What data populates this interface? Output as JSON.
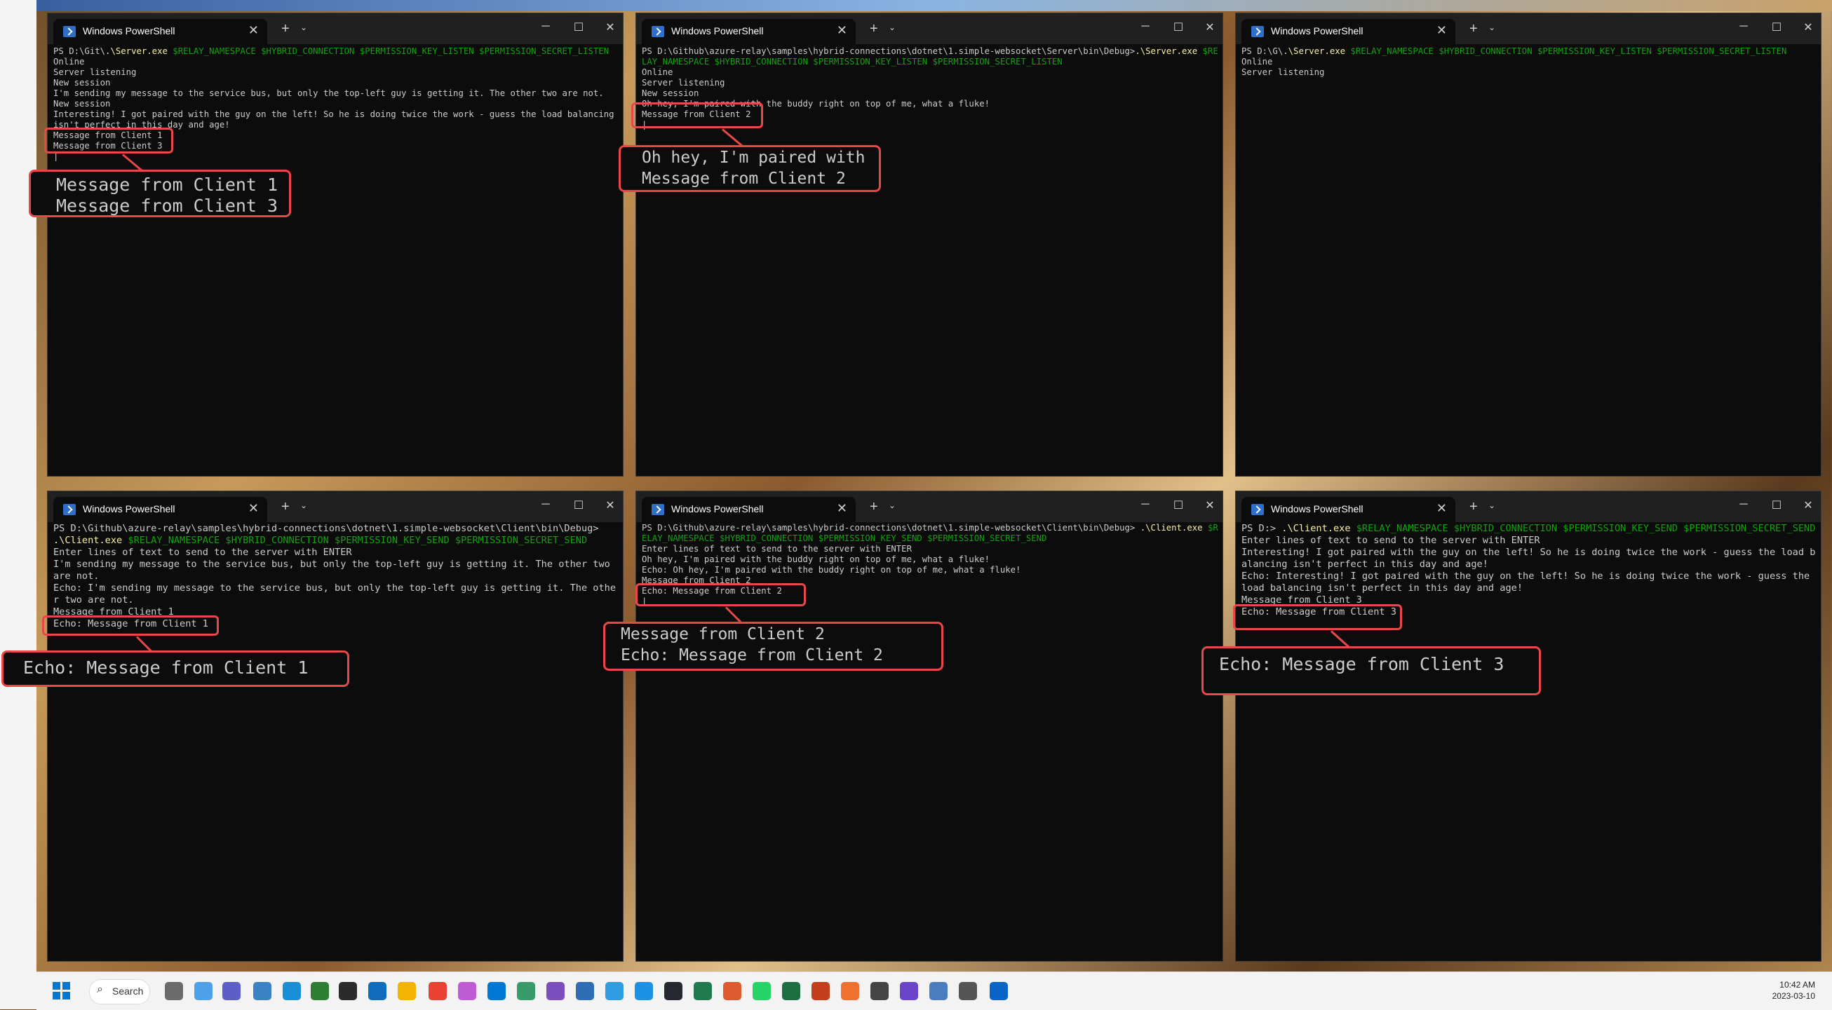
{
  "window_title": "Windows PowerShell",
  "window_controls": {
    "minimize": "─",
    "maximize": "☐",
    "close": "✕"
  },
  "tab_close": "✕",
  "new_tab": "+",
  "dropdown": "⌄",
  "terminals": [
    {
      "segments": [
        [
          {
            "t": "PS D:\\Git\\"
          },
          {
            "t": ".\\Server.exe",
            "c": "y"
          },
          {
            "t": " $RELAY_NAMESPACE $HYBRID_CONNECTION $PERMISSION_KEY_LISTEN $PERMISSION_SECRET_LISTEN",
            "c": "g"
          }
        ],
        [
          {
            "t": "Online"
          }
        ],
        [
          {
            "t": "Server listening"
          }
        ],
        [
          {
            "t": "New session"
          }
        ],
        [
          {
            "t": "I'm sending my message to the service bus, but only the top-left guy is getting it. The other two are not."
          }
        ],
        [
          {
            "t": "New session"
          }
        ],
        [
          {
            "t": "Interesting! I got paired with the guy on the left! So he is doing twice the work - guess the load balancing isn't perfect in this day and age!"
          }
        ],
        [
          {
            "t": "Message from Client 1"
          }
        ],
        [
          {
            "t": "Message from Client 3"
          }
        ],
        [
          {
            "t": "|"
          }
        ]
      ],
      "zoom": [
        "Message from Client 1",
        "Message from Client 3"
      ]
    },
    {
      "segments": [
        [
          {
            "t": "PS D:\\Github\\azure-relay\\samples\\hybrid-connections\\dotnet\\1.simple-websocket\\Server\\bin\\Debug>"
          },
          {
            "t": ".\\Server.exe",
            "c": "y"
          },
          {
            "t": " $RELAY_NAMESPACE $HYBRID_CONNECTION $PERMISSION_KEY_LISTEN $PERMISSION_SECRET_LISTEN",
            "c": "g"
          }
        ],
        [
          {
            "t": "Online"
          }
        ],
        [
          {
            "t": "Server listening"
          }
        ],
        [
          {
            "t": "New session"
          }
        ],
        [
          {
            "t": "Oh hey, I'm paired with the buddy right on top of me, what a fluke!"
          }
        ],
        [
          {
            "t": "Message from Client 2"
          }
        ],
        [
          {
            "t": "|"
          }
        ]
      ],
      "zoom": [
        "Oh hey, I'm paired with",
        "Message from Client 2",
        "|"
      ]
    },
    {
      "segments": [
        [
          {
            "t": "PS D:\\G\\"
          },
          {
            "t": ".\\Server.exe",
            "c": "y"
          },
          {
            "t": " $RELAY_NAMESPACE $HYBRID_CONNECTION $PERMISSION_KEY_LISTEN $PERMISSION_SECRET_LISTEN",
            "c": "g"
          }
        ],
        [
          {
            "t": "Online"
          }
        ],
        [
          {
            "t": "Server listening"
          }
        ]
      ]
    },
    {
      "segments": [
        [
          {
            "t": "PS D:\\Github\\azure-relay\\samples\\hybrid-connections\\dotnet\\1.simple-websocket\\Client\\bin\\Debug> "
          },
          {
            "t": ".\\Client.exe",
            "c": "y"
          },
          {
            "t": " $RELAY_NAMESPACE $HYBRID_CONNECTION $PERMISSION_KEY_SEND $PERMISSION_SECRET_SEND",
            "c": "g"
          }
        ],
        [
          {
            "t": "Enter lines of text to send to the server with ENTER"
          }
        ],
        [
          {
            "t": "I'm sending my message to the service bus, but only the top-left guy is getting it. The other two are not."
          }
        ],
        [
          {
            "t": "Echo: I'm sending my message to the service bus, but only the top-left guy is getting it. The other two are not."
          }
        ],
        [
          {
            "t": "Message from Client 1"
          }
        ],
        [
          {
            "t": "Echo: Message from Client 1"
          }
        ]
      ],
      "zoom": [
        "Echo: Message from Client 1"
      ]
    },
    {
      "segments": [
        [
          {
            "t": "PS D:\\Github\\azure-relay\\samples\\hybrid-connections\\dotnet\\1.simple-websocket\\Client\\bin\\Debug> "
          },
          {
            "t": ".\\Client.exe",
            "c": "y"
          },
          {
            "t": " $RELAY_NAMESPACE $HYBRID_CONNECTION $PERMISSION_KEY_SEND $PERMISSION_SECRET_SEND",
            "c": "g"
          }
        ],
        [
          {
            "t": "Enter lines of text to send to the server with ENTER"
          }
        ],
        [
          {
            "t": "Oh hey, I'm paired with the buddy right on top of me, what a fluke!"
          }
        ],
        [
          {
            "t": "Echo: Oh hey, I'm paired with the buddy right on top of me, what a fluke!"
          }
        ],
        [
          {
            "t": "Message from Client 2"
          }
        ],
        [
          {
            "t": "Echo: Message from Client 2"
          }
        ],
        [
          {
            "t": "|"
          }
        ]
      ],
      "zoom": [
        "Message from Client 2",
        "Echo: Message from Client 2",
        "|"
      ]
    },
    {
      "segments": [
        [
          {
            "t": "PS D:> "
          },
          {
            "t": ".\\Client.exe",
            "c": "y"
          },
          {
            "t": " $RELAY_NAMESPACE $HYBRID_CONNECTION $PERMISSION_KEY_SEND $PERMISSION_SECRET_SEND",
            "c": "g"
          }
        ],
        [
          {
            "t": "Enter lines of text to send to the server with ENTER"
          }
        ],
        [
          {
            "t": "Interesting! I got paired with the guy on the left! So he is doing twice the work - guess the load balancing isn't perfect in this day and age!"
          }
        ],
        [
          {
            "t": "Echo: Interesting! I got paired with the guy on the left! So he is doing twice the work - guess the load balancing isn't perfect in this day and age!"
          }
        ],
        [
          {
            "t": "Message from Client 3"
          }
        ],
        [
          {
            "t": "Echo: Message from Client 3"
          }
        ]
      ],
      "zoom": [
        "Echo: Message from Client 3"
      ]
    }
  ],
  "taskbar": {
    "search_label": "Search",
    "time": "10:42 AM",
    "date": "2023-03-10",
    "icons": [
      "windows-start-icon",
      "task-view-icon",
      "weather-icon",
      "teams-icon",
      "file-app-icon",
      "edge-icon",
      "notepad-icon",
      "terminal-icon",
      "outlook-icon",
      "file-explorer-icon",
      "chrome-icon",
      "paint-icon",
      "vscode-icon",
      "dev-icon",
      "visual-studio-icon",
      "store-icon",
      "docker-app-icon",
      "docker-icon",
      "github-icon",
      "git-icon",
      "app-icon",
      "whatsapp-icon",
      "excel-icon",
      "powerpoint-icon",
      "app-icon-2",
      "wordpad-icon",
      "video-icon",
      "network-icon",
      "settings-icon",
      "remote-icon"
    ]
  },
  "colors": {
    "terminal_bg": "#0c0c0c",
    "highlight": "#e8474a",
    "command": "#f9f1a5",
    "args": "#13a10e"
  }
}
